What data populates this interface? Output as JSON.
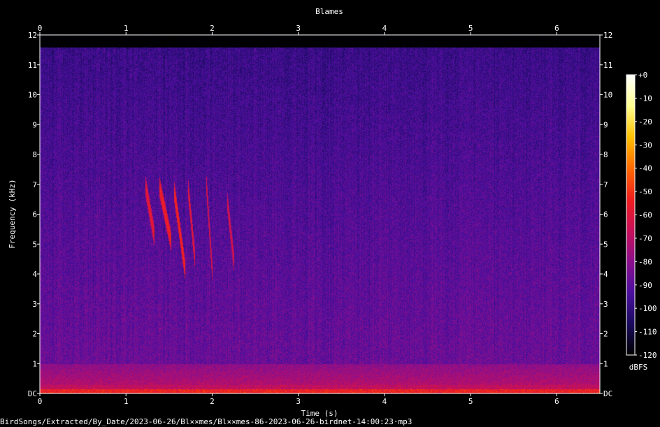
{
  "chart_data": {
    "type": "heatmap",
    "title": "Blames",
    "xlabel": "Time (s)",
    "ylabel": "Frequency (kHz)",
    "xlim": [
      0,
      6.5
    ],
    "ylim": [
      0,
      12
    ],
    "x_ticks": [
      "0",
      "1",
      "2",
      "3",
      "4",
      "5",
      "6"
    ],
    "x_tick_values": [
      0,
      1,
      2,
      3,
      4,
      5,
      6
    ],
    "y_ticks": [
      "DC",
      "1",
      "2",
      "3",
      "4",
      "5",
      "6",
      "7",
      "8",
      "9",
      "10",
      "11",
      "12"
    ],
    "y_tick_values": [
      0,
      1,
      2,
      3,
      4,
      5,
      6,
      7,
      8,
      9,
      10,
      11,
      12
    ],
    "colorbar": {
      "label": "dBFS",
      "range": [
        -120,
        0
      ],
      "ticks": [
        "+0",
        "-10",
        "-20",
        "-30",
        "-40",
        "-50",
        "-60",
        "-70",
        "-80",
        "-90",
        "-100",
        "-110",
        "-120"
      ],
      "tick_values": [
        0,
        -10,
        -20,
        -30,
        -40,
        -50,
        -60,
        -70,
        -80,
        -90,
        -100,
        -110,
        -120
      ],
      "colors": [
        "#000000",
        "#1a0b5e",
        "#4b0fa0",
        "#8c0f8c",
        "#c8105a",
        "#f01e1e",
        "#ff6a00",
        "#ffc000",
        "#ffff90",
        "#ffffff"
      ]
    },
    "signal_ceiling_khz": 11.6,
    "calls": [
      {
        "t0": 1.22,
        "t1": 1.33,
        "f0": 7.0,
        "f1": 5.2,
        "level": -55
      },
      {
        "t0": 1.38,
        "t1": 1.52,
        "f0": 7.0,
        "f1": 5.1,
        "level": -52
      },
      {
        "t0": 1.55,
        "t1": 1.68,
        "f0": 6.9,
        "f1": 4.2,
        "level": -50
      },
      {
        "t0": 1.72,
        "t1": 1.8,
        "f0": 6.8,
        "f1": 4.4,
        "level": -56
      },
      {
        "t0": 1.93,
        "t1": 2.0,
        "f0": 7.0,
        "f1": 4.0,
        "level": -58
      },
      {
        "t0": 2.17,
        "t1": 2.25,
        "f0": 6.5,
        "f1": 4.4,
        "level": -60
      }
    ]
  },
  "footer": {
    "path": "BirdSongs/Extracted/By_Date/2023-06-26/Bl××mes/Bl××mes-86-2023-06-26-birdnet-14:00:23·mp3"
  }
}
